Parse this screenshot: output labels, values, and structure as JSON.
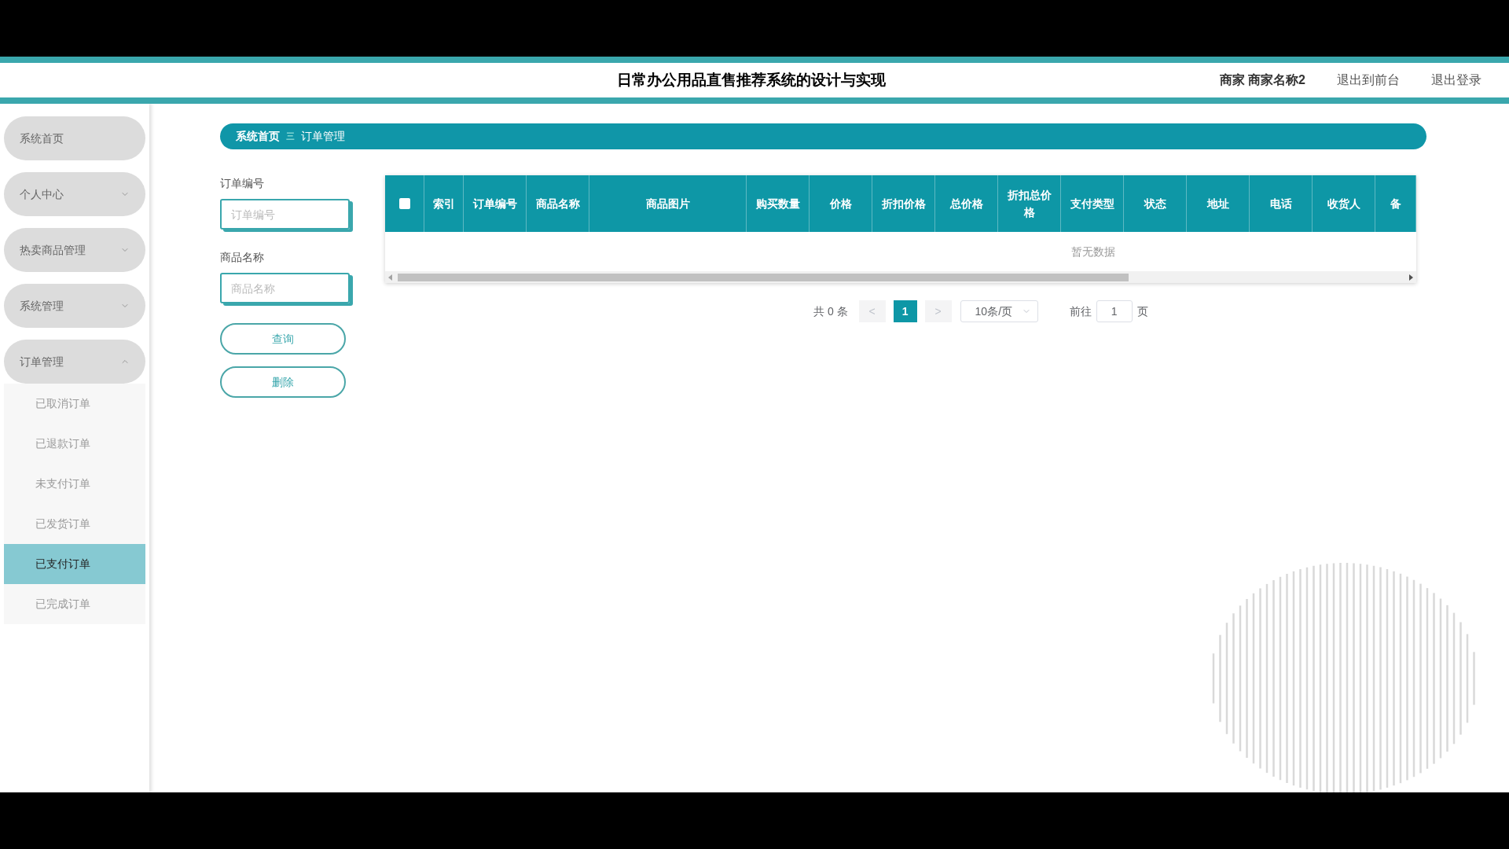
{
  "header": {
    "title": "日常办公用品直售推荐系统的设计与实现",
    "user": "商家 商家名称2",
    "links": [
      "退出到前台",
      "退出登录"
    ]
  },
  "sidebar": {
    "items": [
      {
        "label": "系统首页",
        "kind": "link"
      },
      {
        "label": "个人中心",
        "kind": "menu",
        "expanded": false
      },
      {
        "label": "热卖商品管理",
        "kind": "menu",
        "expanded": false
      },
      {
        "label": "系统管理",
        "kind": "menu",
        "expanded": false
      },
      {
        "label": "订单管理",
        "kind": "menu",
        "expanded": true,
        "children": [
          {
            "label": "已取消订单",
            "selected": false
          },
          {
            "label": "已退款订单",
            "selected": false
          },
          {
            "label": "未支付订单",
            "selected": false
          },
          {
            "label": "已发货订单",
            "selected": false
          },
          {
            "label": "已支付订单",
            "selected": true
          },
          {
            "label": "已完成订单",
            "selected": false
          }
        ]
      }
    ]
  },
  "breadcrumb": {
    "items": [
      "系统首页",
      "订单管理"
    ],
    "separator": "三"
  },
  "search_form": {
    "fields": [
      {
        "label": "订单编号",
        "placeholder": "订单编号"
      },
      {
        "label": "商品名称",
        "placeholder": "商品名称"
      }
    ],
    "buttons": [
      "查询",
      "删除"
    ]
  },
  "table": {
    "select_all_checked": false,
    "columns": [
      "索引",
      "订单编号",
      "商品名称",
      "商品图片",
      "购买数量",
      "价格",
      "折扣价格",
      "总价格",
      "折扣总价格",
      "支付类型",
      "状态",
      "地址",
      "电话",
      "收货人",
      "备"
    ],
    "empty_text": "暂无数据"
  },
  "pagination": {
    "total": "共 0 条",
    "prev": "<",
    "pages": [
      {
        "label": "1",
        "selected": true
      }
    ],
    "next": ">",
    "page_size": "10条/页",
    "goto_label": "前往",
    "goto_value": "1",
    "page_suffix": "页"
  }
}
